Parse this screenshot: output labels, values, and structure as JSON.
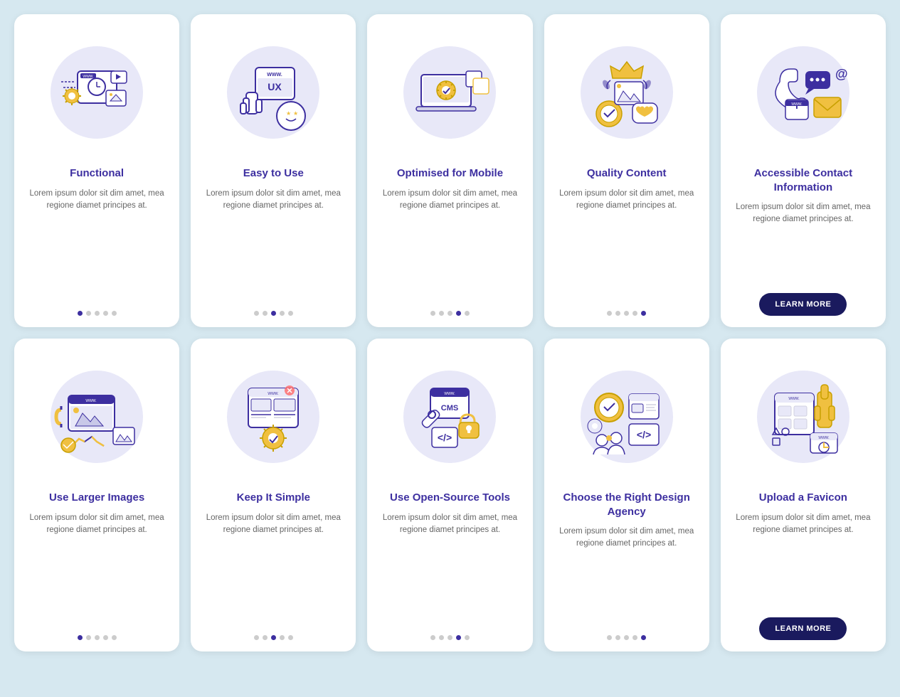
{
  "cards": [
    {
      "id": "functional",
      "title": "Functional",
      "body": "Lorem ipsum dolor sit dim amet, mea regione diamet principes at.",
      "dots": [
        true,
        false,
        false,
        false,
        false
      ],
      "hasButton": false,
      "row": 1
    },
    {
      "id": "easy-to-use",
      "title": "Easy to Use",
      "body": "Lorem ipsum dolor sit dim amet, mea regione diamet principes at.",
      "dots": [
        false,
        false,
        true,
        false,
        false
      ],
      "hasButton": false,
      "row": 1
    },
    {
      "id": "optimised-mobile",
      "title": "Optimised for Mobile",
      "body": "Lorem ipsum dolor sit dim amet, mea regione diamet principes at.",
      "dots": [
        false,
        false,
        false,
        true,
        false
      ],
      "hasButton": false,
      "row": 1
    },
    {
      "id": "quality-content",
      "title": "Quality Content",
      "body": "Lorem ipsum dolor sit dim amet, mea regione diamet principes at.",
      "dots": [
        false,
        false,
        false,
        false,
        true
      ],
      "hasButton": false,
      "row": 1
    },
    {
      "id": "accessible-contact",
      "title": "Accessible Contact Information",
      "body": "Lorem ipsum dolor sit dim amet, mea regione diamet principes at.",
      "dots": [],
      "hasButton": true,
      "buttonLabel": "LEARN MORE",
      "row": 1
    },
    {
      "id": "larger-images",
      "title": "Use Larger Images",
      "body": "Lorem ipsum dolor sit dim amet, mea regione diamet principes at.",
      "dots": [
        true,
        false,
        false,
        false,
        false
      ],
      "hasButton": false,
      "row": 2
    },
    {
      "id": "keep-simple",
      "title": "Keep It Simple",
      "body": "Lorem ipsum dolor sit dim amet, mea regione diamet principes at.",
      "dots": [
        false,
        false,
        true,
        false,
        false
      ],
      "hasButton": false,
      "row": 2
    },
    {
      "id": "open-source",
      "title": "Use Open-Source Tools",
      "body": "Lorem ipsum dolor sit dim amet, mea regione diamet principes at.",
      "dots": [
        false,
        false,
        false,
        true,
        false
      ],
      "hasButton": false,
      "row": 2
    },
    {
      "id": "design-agency",
      "title": "Choose the Right Design Agency",
      "body": "Lorem ipsum dolor sit dim amet, mea regione diamet principes at.",
      "dots": [
        false,
        false,
        false,
        false,
        true
      ],
      "hasButton": false,
      "row": 2
    },
    {
      "id": "favicon",
      "title": "Upload a Favicon",
      "body": "Lorem ipsum dolor sit dim amet, mea regione diamet principes at.",
      "dots": [],
      "hasButton": true,
      "buttonLabel": "LEARN MORE",
      "row": 2
    }
  ]
}
